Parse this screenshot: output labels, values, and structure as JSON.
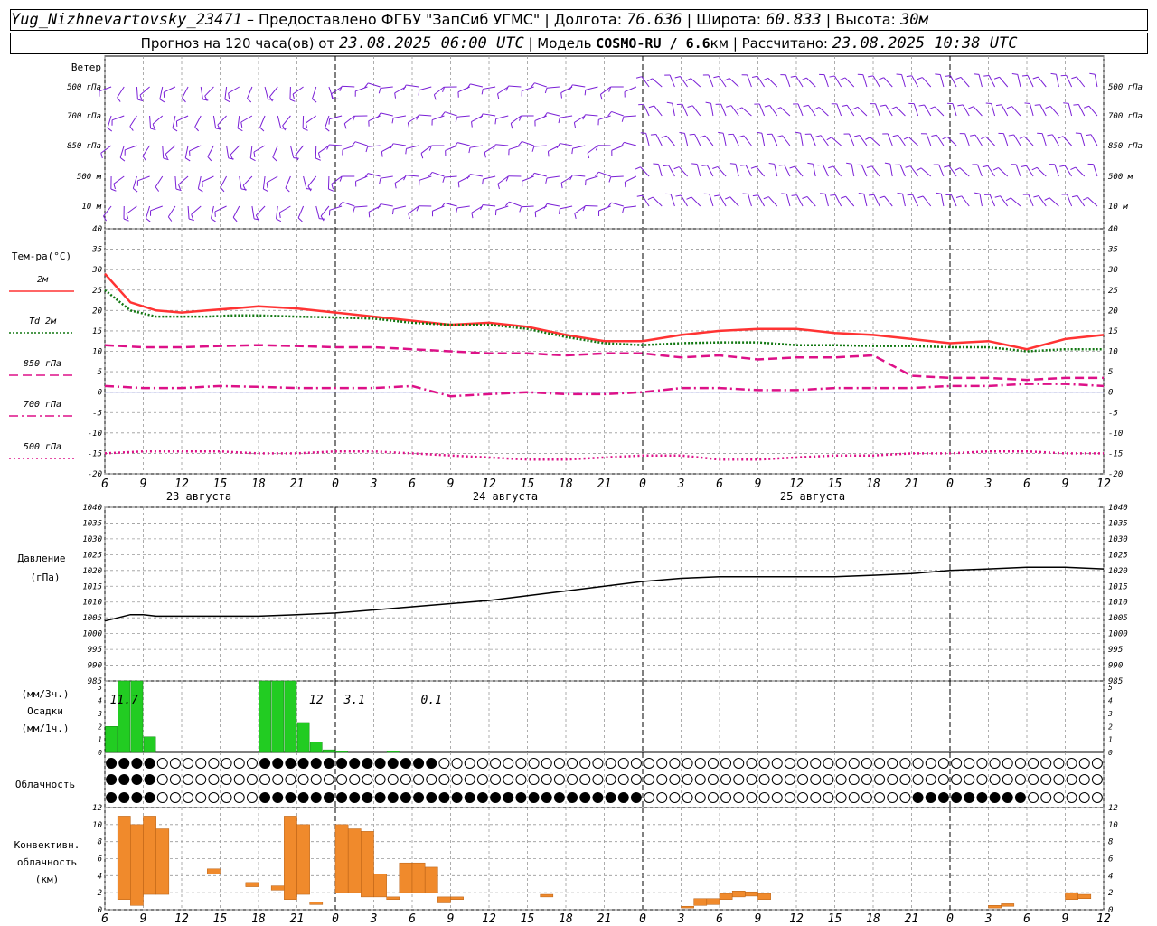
{
  "header": {
    "station": "Yug_Nizhnevartovsky_23471",
    "provider_text": "– Предоставлено ФГБУ \"ЗапСиб УГМС\" | Долгота:",
    "longitude": "76.636",
    "lat_label": "| Широта:",
    "latitude": "60.833",
    "alt_label": "| Высота:",
    "altitude": "30м",
    "forecast_text": "Прогноз на 120 часа(ов) от",
    "forecast_start": "23.08.2025 06:00 UTC",
    "model_label": "| Модель",
    "model_name": "COSMO-RU / 6.6",
    "model_unit": "км | Рассчитано:",
    "computed": "23.08.2025 10:38 UTC"
  },
  "wind_panel": {
    "title": "Ветер",
    "levels": [
      "500 гПа",
      "700 гПа",
      "850 гПа",
      "500 м",
      "10  м"
    ],
    "barb_color": "#7a1fd6"
  },
  "temp_panel": {
    "title": "Тем-ра(°С)",
    "legend": [
      {
        "label": "2м",
        "color": "#ff3333",
        "style": "solid"
      },
      {
        "label": "Td  2м",
        "color": "#117711",
        "style": "dotted"
      },
      {
        "label": "850 гПа",
        "color": "#dd1188",
        "style": "dash"
      },
      {
        "label": "700 гПа",
        "color": "#dd1188",
        "style": "dashdot"
      },
      {
        "label": "500 гПа",
        "color": "#dd1188",
        "style": "dot"
      }
    ]
  },
  "x_ticks": [
    "6",
    "9",
    "12",
    "15",
    "18",
    "21",
    "0",
    "3",
    "6",
    "9",
    "12",
    "15",
    "18",
    "21",
    "0",
    "3",
    "6",
    "9",
    "12",
    "15",
    "18",
    "21",
    "0",
    "3",
    "6",
    "9",
    "12"
  ],
  "dates": [
    "23 августа",
    "24 августа",
    "25 августа"
  ],
  "pressure_panel": {
    "title": "Давление",
    "unit": "(гПа)"
  },
  "precip_panel": {
    "unit_3h": "(мм/3ч.)",
    "title": "Осадки",
    "unit_1h": "(мм/1ч.)",
    "annotations": [
      {
        "x": 1.5,
        "text": "11.7"
      },
      {
        "x": 16.5,
        "text": "12"
      },
      {
        "x": 19.5,
        "text": "3.1"
      },
      {
        "x": 25.5,
        "text": "0.1"
      }
    ]
  },
  "cloud_panel": {
    "title": "Облачность",
    "levels": [
      "high",
      "middle",
      "low"
    ]
  },
  "conv_panel": {
    "title1": "Конвективн.",
    "title2": "облачность",
    "unit": "(км)",
    "color": "#f08a2c"
  },
  "chart_data": [
    {
      "type": "line",
      "name": "temperature",
      "xlim": [
        0,
        78
      ],
      "ylim": [
        -20,
        40
      ],
      "yticks": [
        40,
        35,
        30,
        25,
        20,
        15,
        10,
        5,
        0,
        -5,
        -10,
        -15,
        -20
      ],
      "series": [
        {
          "name": "2м",
          "x": [
            0,
            2,
            4,
            6,
            8,
            10,
            12,
            15,
            18,
            21,
            24,
            27,
            30,
            33,
            36,
            39,
            42,
            45,
            48,
            51,
            54,
            57,
            60,
            63,
            66,
            69,
            72,
            75,
            78
          ],
          "y": [
            29,
            22,
            20,
            19.5,
            20,
            20.5,
            21,
            20.5,
            19.5,
            18.5,
            17.5,
            16.5,
            17,
            16,
            14,
            12.5,
            12.5,
            14,
            15,
            15.5,
            15.5,
            14.5,
            14,
            13,
            12,
            12.5,
            10.5,
            13,
            14
          ]
        },
        {
          "name": "Td  2м",
          "x": [
            0,
            2,
            4,
            6,
            8,
            10,
            12,
            15,
            18,
            21,
            24,
            27,
            30,
            33,
            36,
            39,
            42,
            45,
            48,
            51,
            54,
            57,
            60,
            63,
            66,
            69,
            72,
            75,
            78
          ],
          "y": [
            25,
            20,
            18.5,
            18.5,
            18.5,
            18.8,
            18.8,
            18.5,
            18.3,
            18,
            17,
            16.5,
            16.5,
            15.5,
            13.5,
            12,
            11.5,
            12,
            12.2,
            12.2,
            11.5,
            11.5,
            11.3,
            11.3,
            11,
            11,
            10,
            10.5,
            10.5
          ]
        },
        {
          "name": "850 гПа",
          "x": [
            0,
            3,
            6,
            9,
            12,
            15,
            18,
            21,
            24,
            27,
            30,
            33,
            36,
            39,
            42,
            45,
            48,
            51,
            54,
            57,
            60,
            63,
            66,
            69,
            72,
            75,
            78
          ],
          "y": [
            11.5,
            11,
            11,
            11.3,
            11.5,
            11.3,
            11,
            11,
            10.5,
            10,
            9.5,
            9.5,
            9,
            9.5,
            9.5,
            8.5,
            9,
            8,
            8.5,
            8.5,
            9,
            4,
            3.5,
            3.5,
            3,
            3.5,
            3.5
          ]
        },
        {
          "name": "700 гПа",
          "x": [
            0,
            3,
            6,
            9,
            12,
            15,
            18,
            21,
            24,
            27,
            30,
            33,
            36,
            39,
            42,
            45,
            48,
            51,
            54,
            57,
            60,
            63,
            66,
            69,
            72,
            75,
            78
          ],
          "y": [
            1.5,
            1,
            1,
            1.5,
            1.3,
            1,
            1,
            1,
            1.5,
            -1,
            -0.5,
            0,
            -0.5,
            -0.5,
            0,
            1,
            1,
            0.5,
            0.5,
            1,
            1,
            1,
            1.5,
            1.5,
            2,
            2,
            1.5
          ]
        },
        {
          "name": "500 гПа",
          "x": [
            0,
            3,
            6,
            9,
            12,
            15,
            18,
            21,
            24,
            27,
            30,
            33,
            36,
            39,
            42,
            45,
            48,
            51,
            54,
            57,
            60,
            63,
            66,
            69,
            72,
            75,
            78
          ],
          "y": [
            -15,
            -14.5,
            -14.5,
            -14.5,
            -15,
            -15,
            -14.5,
            -14.5,
            -15,
            -15.5,
            -16,
            -16.5,
            -16.5,
            -16,
            -15.5,
            -15.5,
            -16.5,
            -16.5,
            -16,
            -15.5,
            -15.5,
            -15,
            -15,
            -14.5,
            -14.5,
            -15,
            -15
          ]
        }
      ]
    },
    {
      "type": "line",
      "name": "pressure",
      "xlim": [
        0,
        78
      ],
      "ylim": [
        985,
        1040
      ],
      "yticks": [
        1040,
        1035,
        1030,
        1025,
        1020,
        1015,
        1010,
        1005,
        1000,
        995,
        990,
        985
      ],
      "series": [
        {
          "name": "pressure",
          "x": [
            0,
            1,
            2,
            3,
            4,
            6,
            9,
            12,
            15,
            18,
            21,
            24,
            27,
            30,
            33,
            36,
            39,
            42,
            45,
            48,
            51,
            54,
            57,
            60,
            63,
            66,
            69,
            72,
            75,
            78
          ],
          "y": [
            1004,
            1005,
            1006,
            1006,
            1005.5,
            1005.5,
            1005.5,
            1005.5,
            1006,
            1006.5,
            1007.5,
            1008.5,
            1009.5,
            1010.5,
            1012,
            1013.5,
            1015,
            1016.5,
            1017.5,
            1018,
            1018,
            1018,
            1018,
            1018.5,
            1019,
            1020,
            1020.5,
            1021,
            1021,
            1020.5
          ]
        }
      ]
    },
    {
      "type": "bar",
      "name": "precipitation",
      "ylim": [
        0,
        5.5
      ],
      "yticks": [
        5,
        4,
        3,
        2,
        1,
        0
      ],
      "x": [
        0,
        1,
        2,
        3,
        12,
        13,
        14,
        15,
        16,
        17,
        18,
        22
      ],
      "values": [
        2,
        5.5,
        5.5,
        1.2,
        5.5,
        5.5,
        5.5,
        2.3,
        0.8,
        0.2,
        0.1,
        0.1
      ]
    },
    {
      "type": "bar",
      "name": "convective_cloud",
      "ylim": [
        0,
        12
      ],
      "yticks": [
        12,
        10,
        8,
        6,
        4,
        2,
        0
      ],
      "bars": [
        {
          "x": 1,
          "bottom": 1.2,
          "top": 11
        },
        {
          "x": 2,
          "bottom": 0.5,
          "top": 10
        },
        {
          "x": 3,
          "bottom": 1.8,
          "top": 11
        },
        {
          "x": 4,
          "bottom": 1.8,
          "top": 9.5
        },
        {
          "x": 8,
          "bottom": 4.2,
          "top": 4.8
        },
        {
          "x": 11,
          "bottom": 2.7,
          "top": 3.2
        },
        {
          "x": 13,
          "bottom": 2.3,
          "top": 2.8
        },
        {
          "x": 14,
          "bottom": 1.2,
          "top": 11
        },
        {
          "x": 15,
          "bottom": 1.8,
          "top": 10
        },
        {
          "x": 16,
          "bottom": 0.6,
          "top": 0.9
        },
        {
          "x": 18,
          "bottom": 2,
          "top": 10
        },
        {
          "x": 19,
          "bottom": 2,
          "top": 9.5
        },
        {
          "x": 20,
          "bottom": 1.5,
          "top": 9.2
        },
        {
          "x": 21,
          "bottom": 1.5,
          "top": 4.2
        },
        {
          "x": 22,
          "bottom": 1.2,
          "top": 1.5
        },
        {
          "x": 23,
          "bottom": 2,
          "top": 5.5
        },
        {
          "x": 24,
          "bottom": 2,
          "top": 5.5
        },
        {
          "x": 25,
          "bottom": 2,
          "top": 5
        },
        {
          "x": 26,
          "bottom": 0.8,
          "top": 1.5
        },
        {
          "x": 27,
          "bottom": 1.2,
          "top": 1.5
        },
        {
          "x": 34,
          "bottom": 1.5,
          "top": 1.8
        },
        {
          "x": 45,
          "bottom": 0.2,
          "top": 0.4
        },
        {
          "x": 46,
          "bottom": 0.5,
          "top": 1.3
        },
        {
          "x": 47,
          "bottom": 0.6,
          "top": 1.3
        },
        {
          "x": 48,
          "bottom": 1.2,
          "top": 1.9
        },
        {
          "x": 49,
          "bottom": 1.5,
          "top": 2.2
        },
        {
          "x": 50,
          "bottom": 1.6,
          "top": 2.1
        },
        {
          "x": 51,
          "bottom": 1.2,
          "top": 1.9
        },
        {
          "x": 69,
          "bottom": 0.2,
          "top": 0.5
        },
        {
          "x": 70,
          "bottom": 0.4,
          "top": 0.7
        },
        {
          "x": 75,
          "bottom": 1.2,
          "top": 2
        },
        {
          "x": 76,
          "bottom": 1.3,
          "top": 1.8
        }
      ]
    }
  ]
}
